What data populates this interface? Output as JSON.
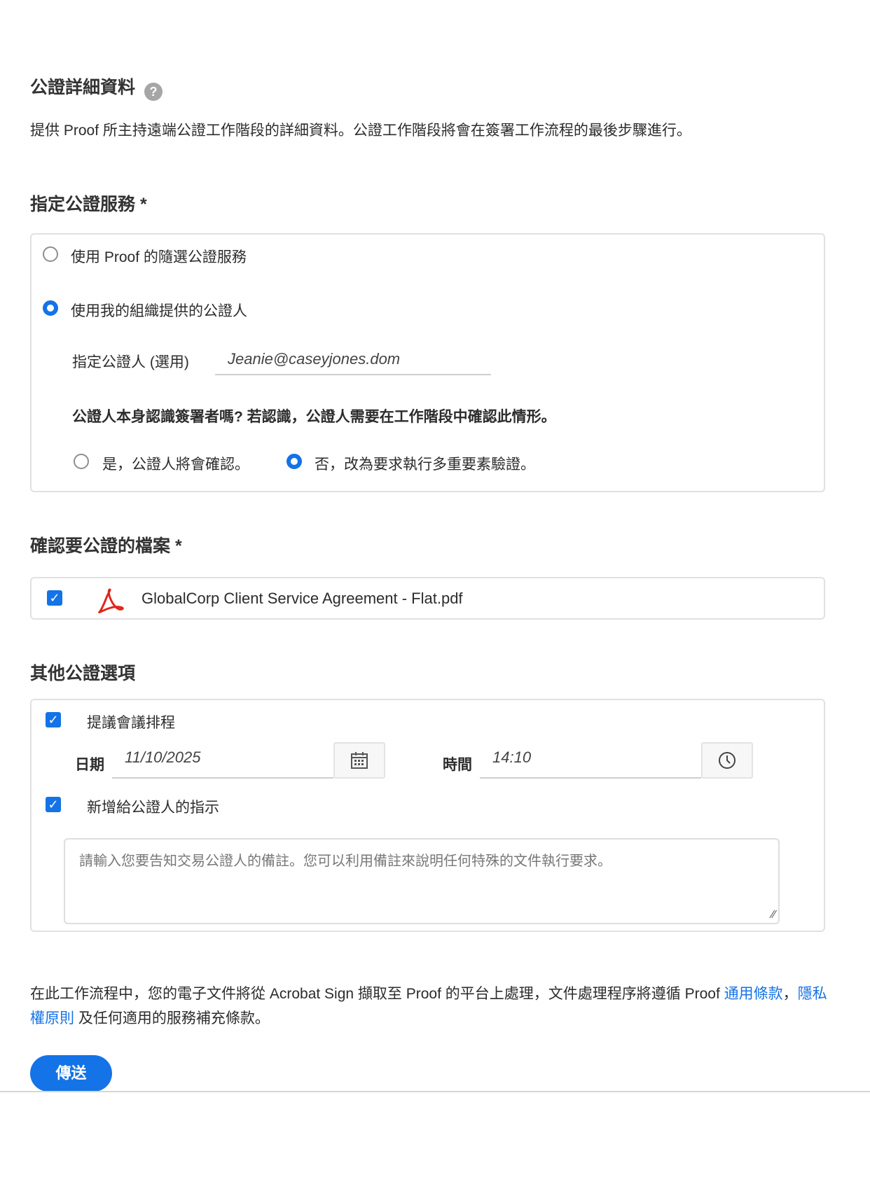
{
  "header": {
    "title": "公證詳細資料",
    "description": "提供 Proof 所主持遠端公證工作階段的詳細資料。公證工作階段將會在簽署工作流程的最後步驟進行。"
  },
  "service": {
    "heading": "指定公證服務",
    "required": "*",
    "option_proof": "使用 Proof 的隨選公證服務",
    "option_org": "使用我的組織提供的公證人",
    "notary_label": "指定公證人 (選用)",
    "notary_value": "Jeanie@caseyjones.dom",
    "question": "公證人本身認識簽署者嗎? 若認識，公證人需要在工作階段中確認此情形。",
    "yes": "是，公證人將會確認。",
    "no": "否，改為要求執行多重要素驗證。"
  },
  "files": {
    "heading": "確認要公證的檔案",
    "required": "*",
    "file_name": "GlobalCorp Client Service Agreement - Flat.pdf"
  },
  "other": {
    "heading": "其他公證選項",
    "schedule_label": "提議會議排程",
    "date_label": "日期",
    "date_value": "11/10/2025",
    "time_label": "時間",
    "time_value": "14:10",
    "instructions_label": "新增給公證人的指示",
    "instructions_placeholder": "請輸入您要告知交易公證人的備註。您可以利用備註來說明任何特殊的文件執行要求。"
  },
  "footer": {
    "text1": "在此工作流程中，您的電子文件將從 Acrobat Sign 擷取至 Proof 的平台上處理，文件處理程序將遵循 Proof ",
    "terms_link": "通用條款",
    "sep": "，",
    "privacy_link": "隱私權原則",
    "text2": " 及任何適用的服務補充條款。",
    "send_button": "傳送"
  },
  "colors": {
    "accent": "#1473e6"
  }
}
